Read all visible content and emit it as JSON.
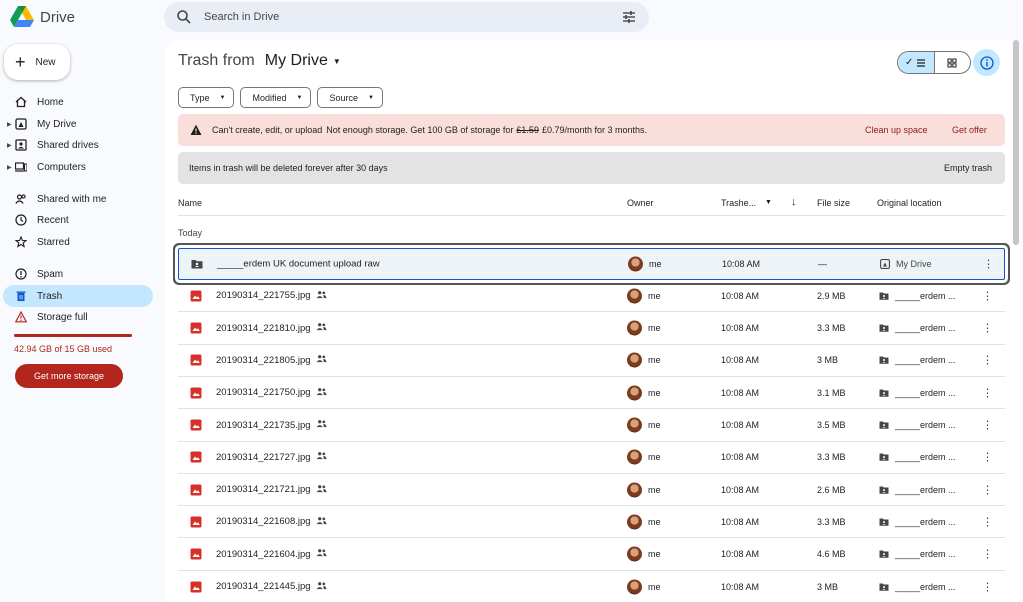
{
  "app": {
    "name": "Drive"
  },
  "search": {
    "placeholder": "Search in Drive"
  },
  "sidebar": {
    "new_label": "New",
    "items": [
      {
        "label": "Home",
        "icon": "home-icon"
      },
      {
        "label": "My Drive",
        "icon": "my-drive-icon"
      },
      {
        "label": "Shared drives",
        "icon": "shared-drives-icon"
      },
      {
        "label": "Computers",
        "icon": "computers-icon"
      },
      {
        "label": "Shared with me",
        "icon": "shared-with-me-icon"
      },
      {
        "label": "Recent",
        "icon": "clock-icon"
      },
      {
        "label": "Starred",
        "icon": "star-icon"
      },
      {
        "label": "Spam",
        "icon": "spam-icon"
      },
      {
        "label": "Trash",
        "icon": "trash-icon",
        "active": true
      },
      {
        "label": "Storage full",
        "icon": "warning-icon"
      }
    ],
    "storage_text": "42.94 GB of 15 GB used",
    "storage_fraction": 1.0,
    "get_storage_label": "Get more storage"
  },
  "main": {
    "title_prefix": "Trash from",
    "title_drive": "My Drive",
    "filters": [
      "Type",
      "Modified",
      "Source"
    ],
    "alert": {
      "bold": "Can't create, edit, or upload",
      "text_before": "Not enough storage. Get 100 GB of storage for",
      "old_price": "£1.59",
      "text_after": "£0.79/month for 3 months.",
      "clean_up": "Clean up space",
      "get_offer": "Get offer"
    },
    "notice": {
      "text": "Items in trash will be deleted forever after 30 days",
      "empty_trash": "Empty trash"
    },
    "columns": {
      "name": "Name",
      "owner": "Owner",
      "trashed": "Trashe...",
      "file_size": "File size",
      "original_location": "Original location"
    },
    "group_label": "Today",
    "rows": [
      {
        "name": "_____erdem UK document upload raw",
        "type": "folder",
        "owner": "me",
        "trashed": "10:08 AM",
        "size": "—",
        "location": "My Drive",
        "selected": true,
        "shared": false
      },
      {
        "name": "20190314_221755.jpg",
        "type": "image",
        "owner": "me",
        "trashed": "10:08 AM",
        "size": "2.9 MB",
        "location": "_____erdem ...",
        "shared": true
      },
      {
        "name": "20190314_221810.jpg",
        "type": "image",
        "owner": "me",
        "trashed": "10:08 AM",
        "size": "3.3 MB",
        "location": "_____erdem ...",
        "shared": true
      },
      {
        "name": "20190314_221805.jpg",
        "type": "image",
        "owner": "me",
        "trashed": "10:08 AM",
        "size": "3 MB",
        "location": "_____erdem ...",
        "shared": true
      },
      {
        "name": "20190314_221750.jpg",
        "type": "image",
        "owner": "me",
        "trashed": "10:08 AM",
        "size": "3.1 MB",
        "location": "_____erdem ...",
        "shared": true
      },
      {
        "name": "20190314_221735.jpg",
        "type": "image",
        "owner": "me",
        "trashed": "10:08 AM",
        "size": "3.5 MB",
        "location": "_____erdem ...",
        "shared": true
      },
      {
        "name": "20190314_221727.jpg",
        "type": "image",
        "owner": "me",
        "trashed": "10:08 AM",
        "size": "3.3 MB",
        "location": "_____erdem ...",
        "shared": true
      },
      {
        "name": "20190314_221721.jpg",
        "type": "image",
        "owner": "me",
        "trashed": "10:08 AM",
        "size": "2.6 MB",
        "location": "_____erdem ...",
        "shared": true
      },
      {
        "name": "20190314_221608.jpg",
        "type": "image",
        "owner": "me",
        "trashed": "10:08 AM",
        "size": "3.3 MB",
        "location": "_____erdem ...",
        "shared": true
      },
      {
        "name": "20190314_221604.jpg",
        "type": "image",
        "owner": "me",
        "trashed": "10:08 AM",
        "size": "4.6 MB",
        "location": "_____erdem ...",
        "shared": true
      },
      {
        "name": "20190314_221445.jpg",
        "type": "image",
        "owner": "me",
        "trashed": "10:08 AM",
        "size": "3 MB",
        "location": "_____erdem ...",
        "shared": true
      }
    ]
  },
  "colors": {
    "accent": "#c2e7ff",
    "danger": "#b3261e",
    "alert_bg": "#f9dedc",
    "image_icon": "#d93025"
  }
}
